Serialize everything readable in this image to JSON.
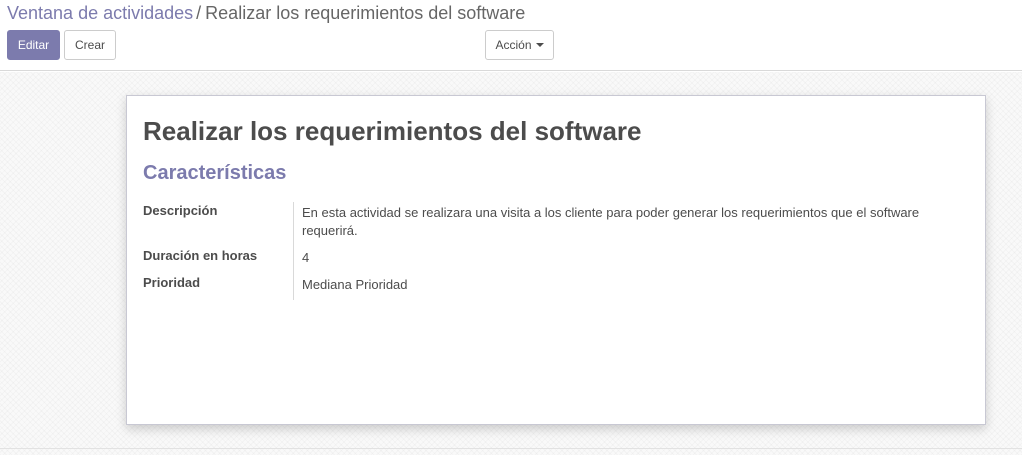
{
  "breadcrumb": {
    "parent": "Ventana de actividades",
    "separator": "/",
    "current": "Realizar los requerimientos del software"
  },
  "toolbar": {
    "edit_label": "Editar",
    "create_label": "Crear",
    "action_label": "Acción"
  },
  "record": {
    "title": "Realizar los requerimientos del software",
    "group_title": "Características",
    "fields": [
      {
        "label": "Descripción",
        "value": "En esta actividad se realizara una visita a los cliente para poder generar los requerimientos que el software requerirá."
      },
      {
        "label": "Duración en horas",
        "value": "4"
      },
      {
        "label": "Prioridad",
        "value": "Mediana Prioridad"
      }
    ]
  },
  "colors": {
    "primary": "#7c7bad",
    "text": "#4c4c4c"
  },
  "icons": {
    "action_dropdown": "caret-down-icon"
  }
}
